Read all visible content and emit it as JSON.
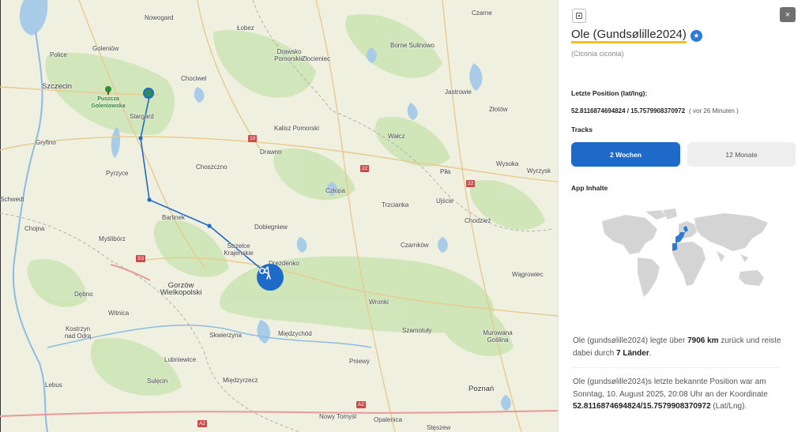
{
  "map": {
    "places": [
      {
        "name": "Nowogard",
        "cls": ""
      },
      {
        "name": "Łobez",
        "cls": ""
      },
      {
        "name": "Drawsko Pomorskie",
        "cls": ""
      },
      {
        "name": "Złocieniec",
        "cls": ""
      },
      {
        "name": "Borne Sulinowo",
        "cls": ""
      },
      {
        "name": "Czarne",
        "cls": ""
      },
      {
        "name": "Police",
        "cls": ""
      },
      {
        "name": "Goleniów",
        "cls": ""
      },
      {
        "name": "Szczecin",
        "cls": "big"
      },
      {
        "name": "Chociwel",
        "cls": ""
      },
      {
        "name": "Stargard",
        "cls": ""
      },
      {
        "name": "Jastrowie",
        "cls": ""
      },
      {
        "name": "Złotów",
        "cls": ""
      },
      {
        "name": "Kalisz Pomorski",
        "cls": ""
      },
      {
        "name": "Gryfino",
        "cls": ""
      },
      {
        "name": "Wałcz",
        "cls": ""
      },
      {
        "name": "Drawno",
        "cls": ""
      },
      {
        "name": "Wysoka",
        "cls": ""
      },
      {
        "name": "Pyrzyce",
        "cls": ""
      },
      {
        "name": "Choszczno",
        "cls": ""
      },
      {
        "name": "Piła",
        "cls": ""
      },
      {
        "name": "Wyrzysk",
        "cls": ""
      },
      {
        "name": "Człopa",
        "cls": ""
      },
      {
        "name": "Schwedt",
        "cls": ""
      },
      {
        "name": "Trzcianka",
        "cls": ""
      },
      {
        "name": "Ujście",
        "cls": ""
      },
      {
        "name": "Barlinek",
        "cls": ""
      },
      {
        "name": "Chodzież",
        "cls": ""
      },
      {
        "name": "Chojna",
        "cls": ""
      },
      {
        "name": "Dobiegniew",
        "cls": ""
      },
      {
        "name": "Myślibórz",
        "cls": ""
      },
      {
        "name": "Czarnków",
        "cls": ""
      },
      {
        "name": "Strzelce Krajeńskie",
        "cls": ""
      },
      {
        "name": "Drezdenko",
        "cls": ""
      },
      {
        "name": "Wągrowiec",
        "cls": ""
      },
      {
        "name": "Gorzów Wielkopolski",
        "cls": "big"
      },
      {
        "name": "Dębno",
        "cls": ""
      },
      {
        "name": "Wronki",
        "cls": ""
      },
      {
        "name": "Witnica",
        "cls": ""
      },
      {
        "name": "Szamotuły",
        "cls": ""
      },
      {
        "name": "Kostrzyn nad Odrą",
        "cls": ""
      },
      {
        "name": "Skwierzyna",
        "cls": ""
      },
      {
        "name": "Międzychód",
        "cls": ""
      },
      {
        "name": "Murowana Goślina",
        "cls": ""
      },
      {
        "name": "Lubniewice",
        "cls": ""
      },
      {
        "name": "Pniewy",
        "cls": ""
      },
      {
        "name": "Lebus",
        "cls": ""
      },
      {
        "name": "Sulęcin",
        "cls": ""
      },
      {
        "name": "Międzyrzecz",
        "cls": ""
      },
      {
        "name": "Poznań",
        "cls": "big"
      },
      {
        "name": "Nowy Tomyśl",
        "cls": ""
      },
      {
        "name": "Opalenica",
        "cls": ""
      },
      {
        "name": "Stęszew",
        "cls": ""
      },
      {
        "name": "Puszcza Goleniowska",
        "cls": "green"
      }
    ],
    "roads": [
      "10",
      "22",
      "22",
      "S3",
      "A2",
      "A2"
    ],
    "track_color": "#1e6ac8"
  },
  "panel": {
    "top_left_icon": "settings-icon",
    "close_label": "×",
    "bird_title": "Ole (Gundsølille2024)",
    "species": "(Ciconia ciconia)",
    "last_position_label": "Letzte Position (lat/lng):",
    "coordinates": "52.8116874694824 / 15.7579908370972",
    "time_ago": "( vor 26 Minuten )",
    "tracks_label": "Tracks",
    "tab_2w": "2 Wochen",
    "tab_12m": "12 Monate",
    "app_content_label": "App Inhalte",
    "stats": {
      "pre": "Ole (gundsølille2024) legte über ",
      "distance": "7906 km",
      "mid": " zurück und reiste dabei durch ",
      "countries": "7 Länder",
      "post": "."
    },
    "last_known": {
      "pre": "Ole (gundsølille2024)s letzte bekannte Position war am Sonntag, 10. August 2025, 20:08 Uhr an der Koordinate ",
      "coords": "52.8116874694824/15.7579908370972",
      "post": " (Lat/Lng)."
    },
    "accent_color": "#1e6ac8",
    "highlight_color": "#f2c028"
  }
}
